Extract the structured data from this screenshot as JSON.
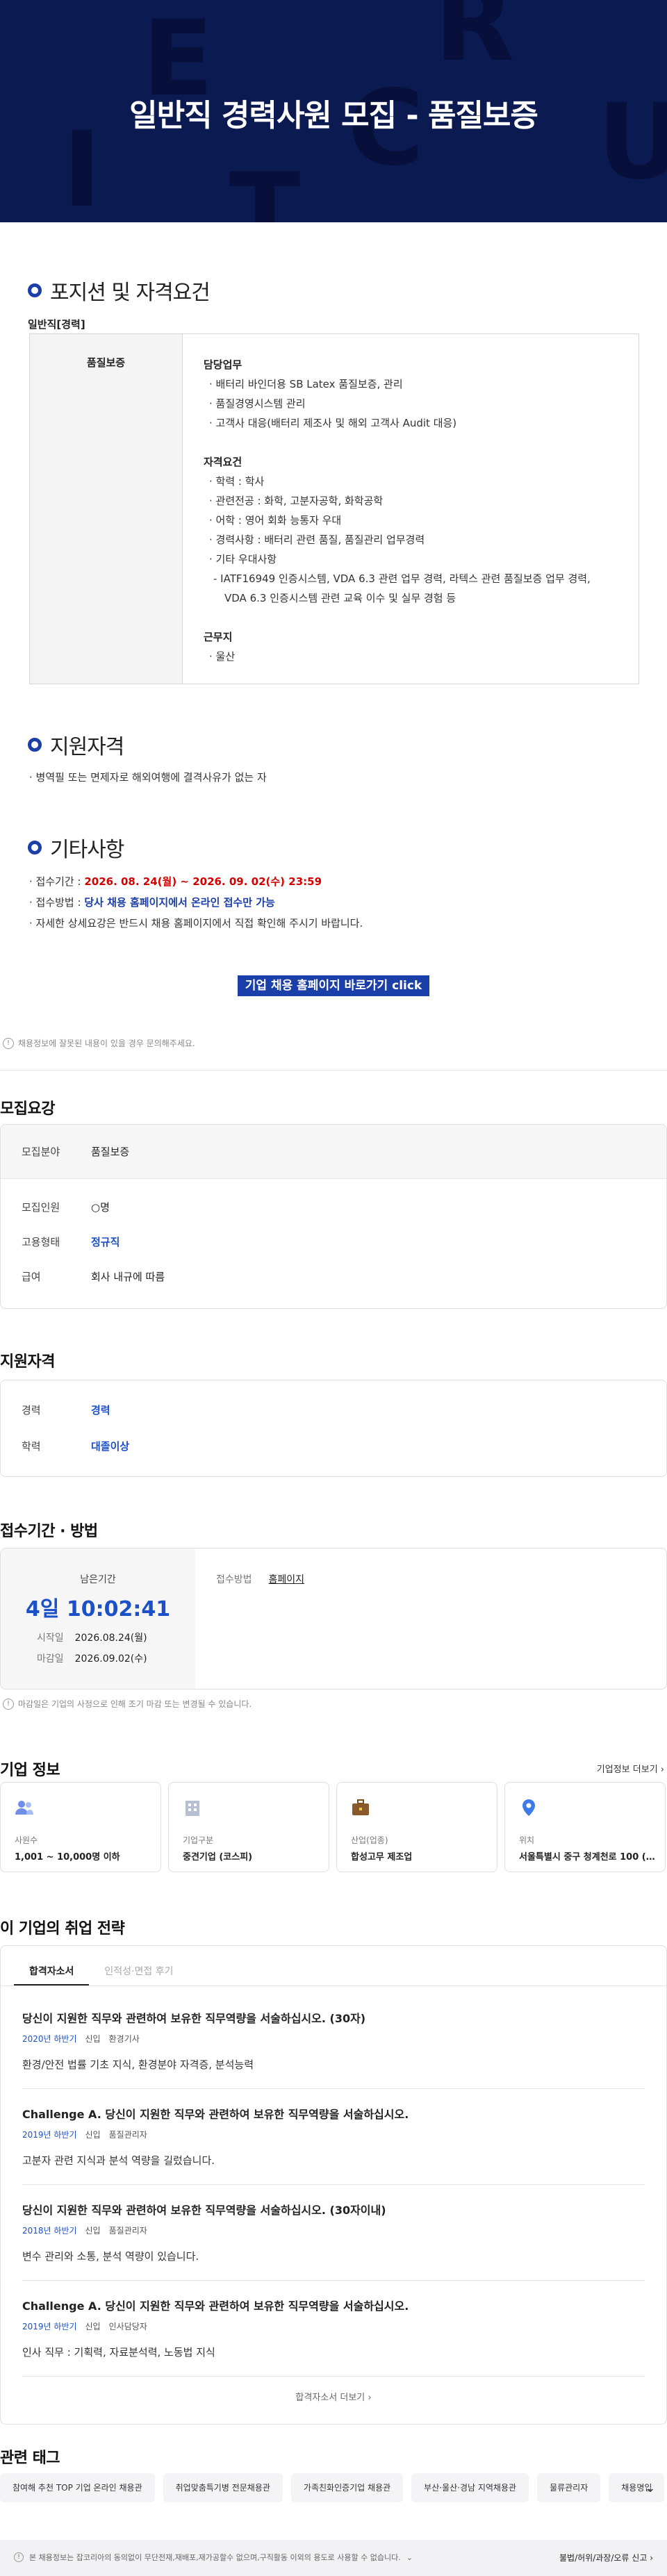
{
  "hero": {
    "title": "일반직 경력사원 모집 - 품질보증",
    "letters": [
      "E",
      "R",
      "C",
      "I",
      "U",
      "T"
    ]
  },
  "position": {
    "heading": "포지션 및 자격요건",
    "sub_label": "일반직[경력]",
    "role": "품질보증",
    "duty_title": "담당업무",
    "duties": [
      "· 배터리 바인더용 SB Latex 품질보증, 관리",
      "· 품질경영시스템 관리",
      "· 고객사 대응(배터리 제조사 및 해외 고객사 Audit 대응)"
    ],
    "qual_title": "자격요건",
    "quals": [
      "· 학력 : 학사",
      "· 관련전공 : 화학, 고분자공학, 화학공학",
      "· 어학 : 영어 회화 능통자 우대",
      "· 경력사항 : 배터리 관련 품질, 품질관리 업무경력",
      "· 기타 우대사항"
    ],
    "pref_line1": "- IATF16949 인증시스템, VDA 6.3 관련 업무 경력, 라텍스 관련 품질보증 업무 경력,",
    "pref_line2": "VDA 6.3 인증시스템 관련 교육 이수 및 실무 경험 등",
    "loc_title": "근무지",
    "loc": "· 울산"
  },
  "eligibility": {
    "heading": "지원자격",
    "text": "· 병역필 또는 면제자로 해외여행에 결격사유가 없는 자"
  },
  "etc": {
    "heading": "기타사항",
    "period_label": "· 접수기간 : ",
    "period": "2026. 08. 24(월) ~ 2026. 09. 02(수) 23:59",
    "method_label": "· 접수방법 : ",
    "method": "당사 채용 홈페이지에서 온라인 접수만 가능",
    "detail": "· 자세한 상세요강은 반드시 채용 홈페이지에서 직접 확인해 주시기 바랍니다.",
    "cta": "기업 채용 홈페이지 바로가기 click"
  },
  "notice_report": "채용정보에 잘못된 내용이 있을 경우 문의해주세요.",
  "summary": {
    "title": "모집요강",
    "rows": [
      {
        "k": "모집분야",
        "v": "품질보증"
      },
      {
        "k": "모집인원",
        "v": "○명"
      },
      {
        "k": "고용형태",
        "v": "정규직"
      },
      {
        "k": "급여",
        "v": "회사 내규에 따름"
      }
    ]
  },
  "qualification": {
    "title": "지원자격",
    "rows": [
      {
        "k": "경력",
        "v": "경력"
      },
      {
        "k": "학력",
        "v": "대졸이상"
      }
    ]
  },
  "apply": {
    "title": "접수기간 · 방법",
    "remain_label": "남은기간",
    "remain": "4일 10:02:41",
    "start_label": "시작일",
    "start": "2026.08.24(월)",
    "end_label": "마감일",
    "end": "2026.09.02(수)",
    "method_label": "접수방법",
    "method": "홈페이지",
    "notice": "마감일은 기업의 사정으로 인해 조기 마감 또는 변경될 수 있습니다."
  },
  "company": {
    "title": "기업 정보",
    "more": "기업정보 더보기",
    "cards": [
      {
        "label": "사원수",
        "value": "1,001 ~ 10,000명 이하",
        "icon": "people-icon"
      },
      {
        "label": "기업구분",
        "value": "중견기업 (코스피)",
        "icon": "building-icon"
      },
      {
        "label": "산업(업종)",
        "value": "합성고무 제조업",
        "icon": "briefcase-icon"
      },
      {
        "label": "위치",
        "value": "서울특별시 중구 청계천로 100 (…",
        "icon": "location-pin-icon"
      }
    ]
  },
  "strategy": {
    "title": "이 기업의 취업 전략",
    "tabs": [
      "합격자소서",
      "인적성·면접 후기"
    ],
    "items": [
      {
        "q": "당신이 지원한 직무와 관련하여 보유한 직무역량을 서술하십시오. (30자)",
        "year": "2020년 하반기",
        "type": "신입",
        "job": "환경기사",
        "a": "환경/안전 법률 기초 지식, 환경분야 자격증, 분석능력"
      },
      {
        "q": "Challenge A. 당신이 지원한 직무와 관련하여 보유한 직무역량을 서술하십시오.",
        "year": "2019년 하반기",
        "type": "신입",
        "job": "품질관리자",
        "a": "고분자 관련 지식과 분석 역량을 길렀습니다."
      },
      {
        "q": "당신이 지원한 직무와 관련하여 보유한 직무역량을 서술하십시오. (30자이내)",
        "year": "2018년 하반기",
        "type": "신입",
        "job": "품질관리자",
        "a": "변수 관리와 소통, 분석 역량이 있습니다."
      },
      {
        "q": "Challenge A. 당신이 지원한 직무와 관련하여 보유한 직무역량을 서술하십시오.",
        "year": "2019년 하반기",
        "type": "신입",
        "job": "인사담당자",
        "a": "인사 직무 : 기획력, 자료분석력, 노동법 지식"
      }
    ],
    "more": "합격자소서 더보기"
  },
  "tags": {
    "title": "관련 태그",
    "items": [
      "참여해 추천 TOP 기업 온라인 채용관",
      "취업맞춤특기병 전문채용관",
      "가족친화인증기업 채용관",
      "부산·울산·경남 지역채용관",
      "물류관리자",
      "채용명입"
    ]
  },
  "footer": {
    "notice": "본 채용정보는 잡코리아의 동의없이 무단전재,재배포,재가공할수 없으며,구직활동 이외의 용도로 사용할 수 없습니다.",
    "report": "불법/허위/과장/오류 신고"
  }
}
